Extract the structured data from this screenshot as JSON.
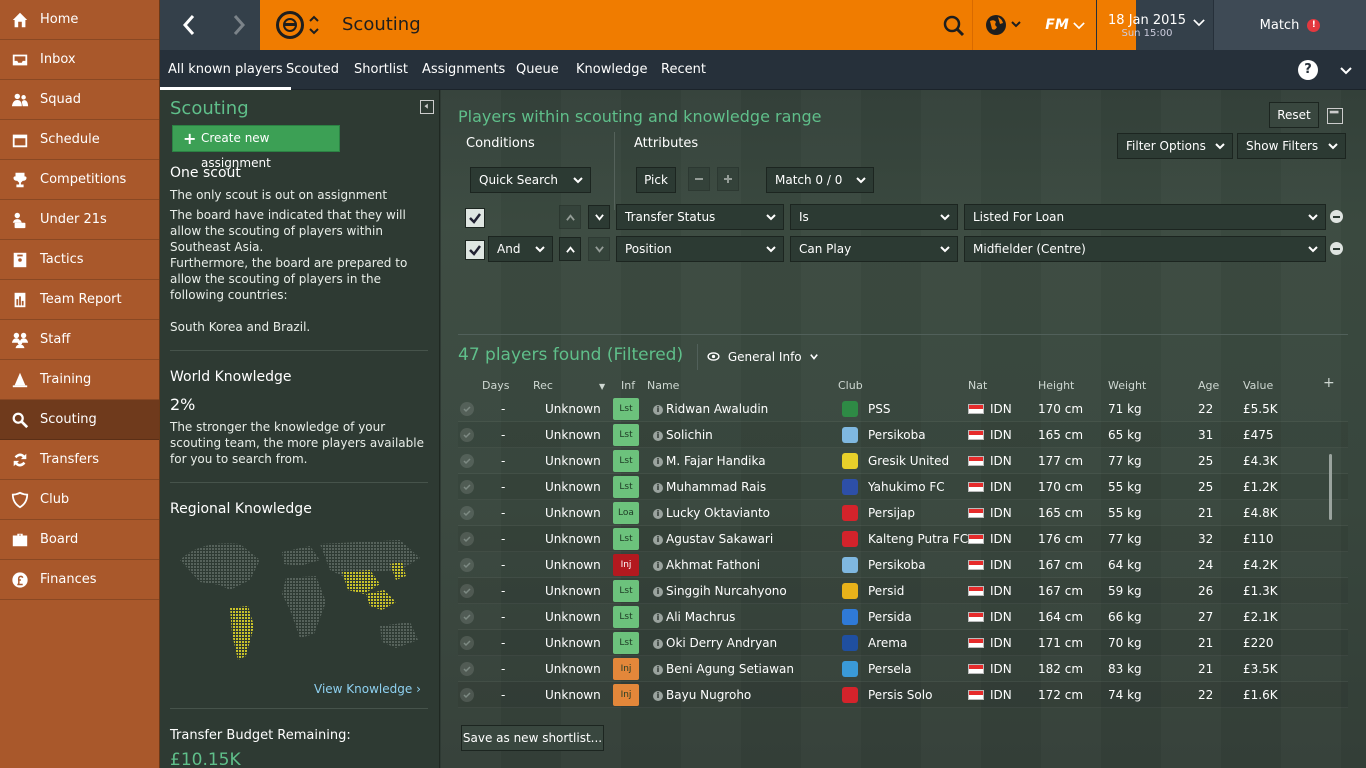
{
  "sidebar": {
    "items": [
      {
        "label": "Home",
        "icon": "home-icon"
      },
      {
        "label": "Inbox",
        "icon": "inbox-icon"
      },
      {
        "label": "Squad",
        "icon": "squad-icon"
      },
      {
        "label": "Schedule",
        "icon": "calendar-icon"
      },
      {
        "label": "Competitions",
        "icon": "trophy-icon"
      },
      {
        "label": "Under 21s",
        "icon": "under21-icon"
      },
      {
        "label": "Tactics",
        "icon": "tactics-icon"
      },
      {
        "label": "Team Report",
        "icon": "report-icon"
      },
      {
        "label": "Staff",
        "icon": "staff-icon"
      },
      {
        "label": "Training",
        "icon": "training-icon"
      },
      {
        "label": "Scouting",
        "icon": "search-icon"
      },
      {
        "label": "Transfers",
        "icon": "transfers-icon"
      },
      {
        "label": "Club",
        "icon": "shield-icon"
      },
      {
        "label": "Board",
        "icon": "briefcase-icon"
      },
      {
        "label": "Finances",
        "icon": "pound-icon"
      }
    ],
    "active": "Scouting"
  },
  "topbar": {
    "title": "Scouting",
    "fm_label": "FM",
    "date": "18 Jan 2015",
    "time": "Sun 15:00",
    "match_label": "Match",
    "match_alert": "!",
    "accent_color": "#f07c00"
  },
  "subtabs": [
    "All known players",
    "Scouted",
    "Shortlist",
    "Assignments",
    "Queue",
    "Knowledge",
    "Recent"
  ],
  "help_label": "?",
  "left_panel": {
    "title": "Scouting",
    "create_button": "Create new assignment",
    "scout_heading": "One scout",
    "scout_status": "The only scout is out on assignment",
    "board_text_1": "The board have indicated that they will allow the scouting of players within Southeast Asia.",
    "board_text_2": "Furthermore, the board are prepared to allow the scouting of players in the following countries:",
    "countries": "South Korea and Brazil.",
    "world_knowledge_heading": "World Knowledge",
    "world_knowledge_value": "2%",
    "world_knowledge_text": "The stronger the knowledge of your scouting team, the more players available for you to search from.",
    "regional_heading": "Regional Knowledge",
    "view_knowledge": "View Knowledge",
    "budget_label": "Transfer Budget Remaining:",
    "budget_value": "£10.15K"
  },
  "main": {
    "title": "Players within scouting and knowledge range",
    "reset": "Reset",
    "conditions_label": "Conditions",
    "attributes_label": "Attributes",
    "filter_options": "Filter Options",
    "show_filters": "Show Filters",
    "quick_search": "Quick Search",
    "pick": "Pick",
    "match_count": "Match 0 / 0",
    "filters": [
      {
        "connector": "",
        "field": "Transfer Status",
        "operator": "Is",
        "value": "Listed For Loan"
      },
      {
        "connector": "And",
        "field": "Position",
        "operator": "Can Play",
        "value": "Midfielder (Centre)"
      }
    ],
    "found": "47 players found (Filtered)",
    "view": "General Info",
    "save_shortlist": "Save as new shortlist..."
  },
  "table": {
    "headers": [
      "Days",
      "Rec",
      "Inf",
      "Name",
      "Club",
      "Nat",
      "Height",
      "Weight",
      "Age",
      "Value"
    ],
    "add_column": "+",
    "rows": [
      {
        "days": "-",
        "rec": "Unknown",
        "inf": "Lst",
        "inf_color": "#6cc27c",
        "name": "Ridwan Awaludin",
        "club": "PSS",
        "crest": "#2e8a45",
        "nat": "IDN",
        "height": "170 cm",
        "weight": "71 kg",
        "age": "22",
        "value": "£5.5K"
      },
      {
        "days": "-",
        "rec": "Unknown",
        "inf": "Lst",
        "inf_color": "#6cc27c",
        "name": "Solichin",
        "club": "Persikoba",
        "crest": "#7fb8e0",
        "nat": "IDN",
        "height": "165 cm",
        "weight": "65 kg",
        "age": "31",
        "value": "£475"
      },
      {
        "days": "-",
        "rec": "Unknown",
        "inf": "Lst",
        "inf_color": "#6cc27c",
        "name": "M. Fajar Handika",
        "club": "Gresik United",
        "crest": "#e8d02a",
        "nat": "IDN",
        "height": "177 cm",
        "weight": "77 kg",
        "age": "25",
        "value": "£4.3K"
      },
      {
        "days": "-",
        "rec": "Unknown",
        "inf": "Lst",
        "inf_color": "#6cc27c",
        "name": "Muhammad Rais",
        "club": "Yahukimo FC",
        "crest": "#2d4fa8",
        "nat": "IDN",
        "height": "170 cm",
        "weight": "55 kg",
        "age": "25",
        "value": "£1.2K"
      },
      {
        "days": "-",
        "rec": "Unknown",
        "inf": "Loa",
        "inf_color": "#6cc27c",
        "name": "Lucky Oktavianto",
        "club": "Persijap",
        "crest": "#d4232b",
        "nat": "IDN",
        "height": "165 cm",
        "weight": "55 kg",
        "age": "21",
        "value": "£4.8K"
      },
      {
        "days": "-",
        "rec": "Unknown",
        "inf": "Lst",
        "inf_color": "#6cc27c",
        "name": "Agustav Sakawari",
        "club": "Kalteng Putra FC",
        "crest": "#d4232b",
        "nat": "IDN",
        "height": "176 cm",
        "weight": "77 kg",
        "age": "32",
        "value": "£110"
      },
      {
        "days": "-",
        "rec": "Unknown",
        "inf": "Inj",
        "inf_color": "#b3191f",
        "name": "Akhmat Fathoni",
        "club": "Persikoba",
        "crest": "#7fb8e0",
        "nat": "IDN",
        "height": "167 cm",
        "weight": "64 kg",
        "age": "24",
        "value": "£4.2K"
      },
      {
        "days": "-",
        "rec": "Unknown",
        "inf": "Lst",
        "inf_color": "#6cc27c",
        "name": "Singgih Nurcahyono",
        "club": "Persid",
        "crest": "#e8b21a",
        "nat": "IDN",
        "height": "167 cm",
        "weight": "59 kg",
        "age": "26",
        "value": "£1.3K"
      },
      {
        "days": "-",
        "rec": "Unknown",
        "inf": "Lst",
        "inf_color": "#6cc27c",
        "name": "Ali Machrus",
        "club": "Persida",
        "crest": "#2f7ad8",
        "nat": "IDN",
        "height": "164 cm",
        "weight": "66 kg",
        "age": "27",
        "value": "£2.1K"
      },
      {
        "days": "-",
        "rec": "Unknown",
        "inf": "Lst",
        "inf_color": "#6cc27c",
        "name": "Oki Derry Andryan",
        "club": "Arema",
        "crest": "#1f4fa0",
        "nat": "IDN",
        "height": "171 cm",
        "weight": "70 kg",
        "age": "21",
        "value": "£220"
      },
      {
        "days": "-",
        "rec": "Unknown",
        "inf": "Inj",
        "inf_color": "#e3873a",
        "name": "Beni Agung Setiawan",
        "club": "Persela",
        "crest": "#3a9ad8",
        "nat": "IDN",
        "height": "182 cm",
        "weight": "83 kg",
        "age": "21",
        "value": "£3.5K"
      },
      {
        "days": "-",
        "rec": "Unknown",
        "inf": "Inj",
        "inf_color": "#e3873a",
        "name": "Bayu Nugroho",
        "club": "Persis Solo",
        "crest": "#d4232b",
        "nat": "IDN",
        "height": "172 cm",
        "weight": "74 kg",
        "age": "22",
        "value": "£1.6K"
      }
    ]
  }
}
